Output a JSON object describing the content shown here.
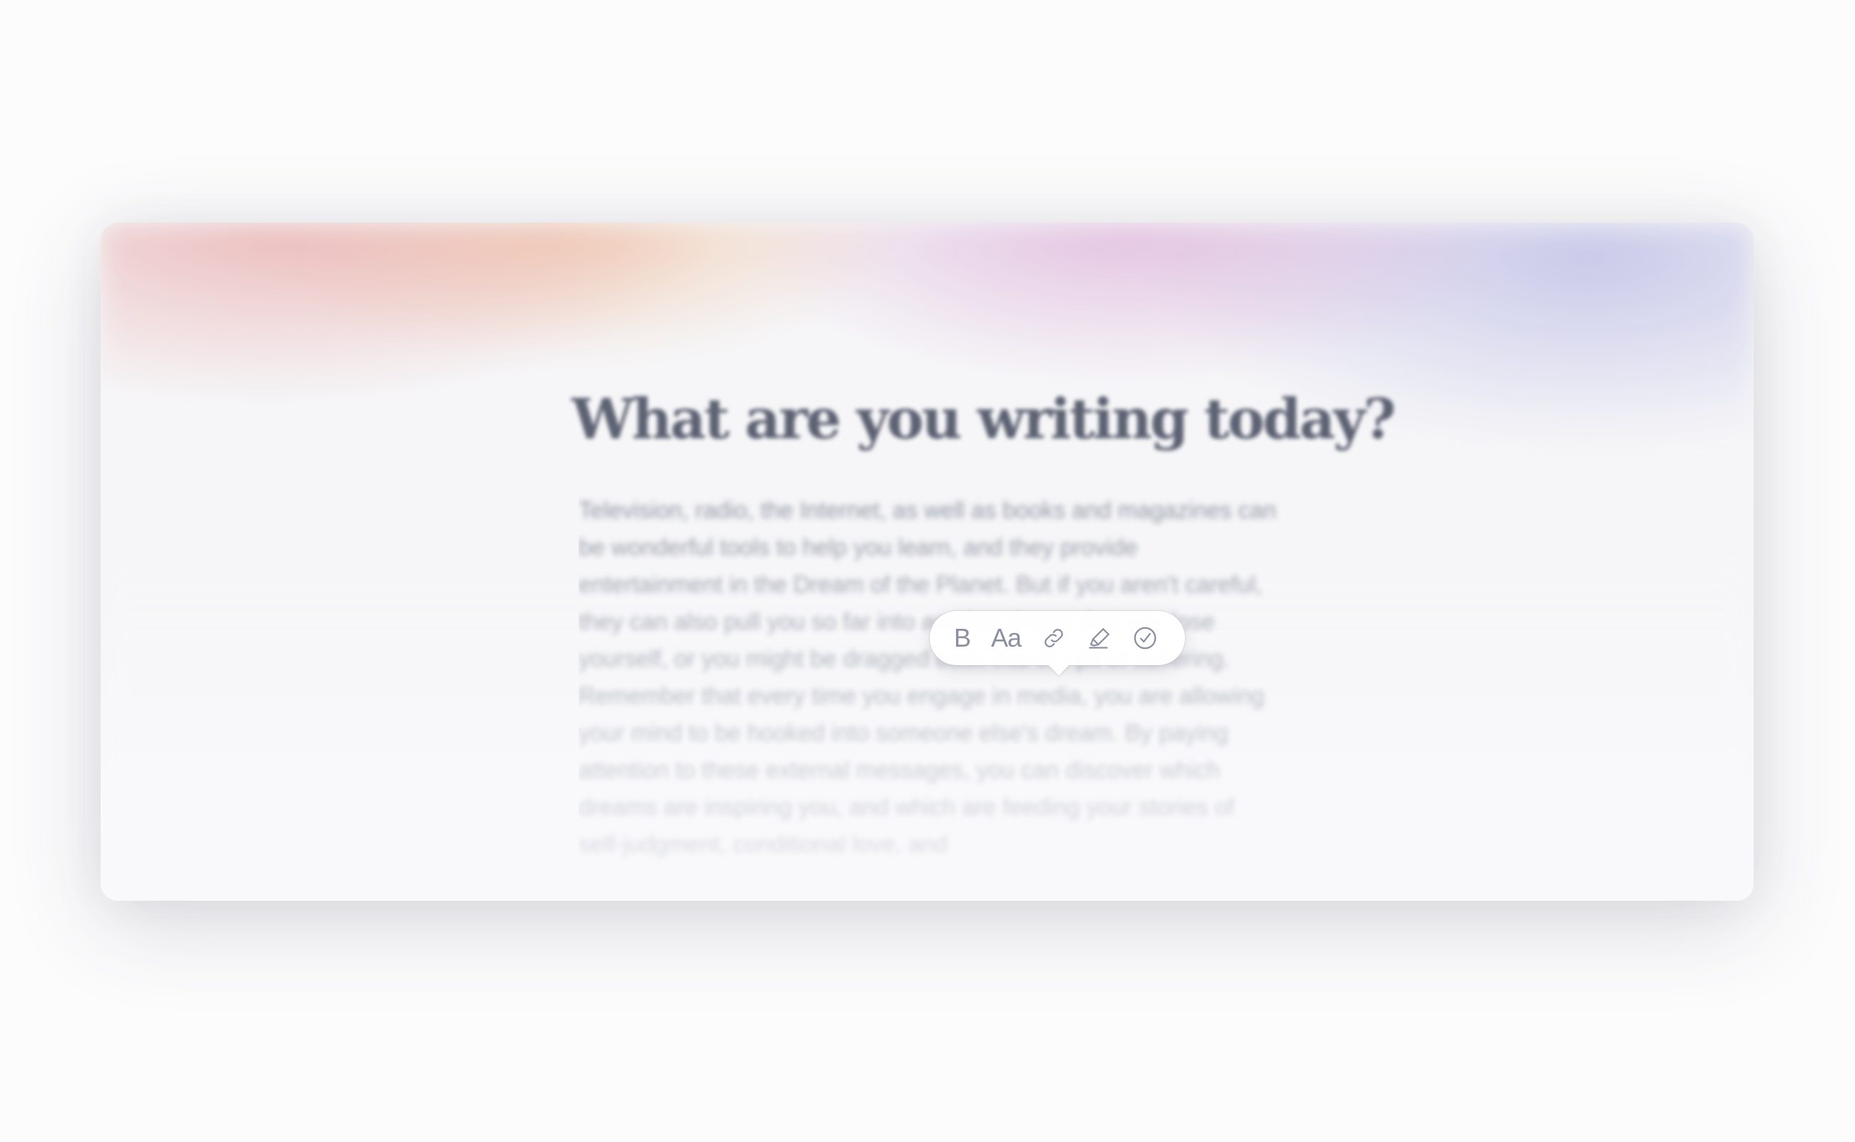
{
  "editor": {
    "title": "What are you writing today?",
    "body": "Television, radio, the Internet, as well as books and magazines can be wonderful tools to help you learn, and they provide entertainment in the Dream of the Planet. But if you aren't careful, they can also pull you so far into another dream that you lose yourself, or you might be dragged back into the pit of suffering. Remember that every time you engage in media, you are allowing your mind to be hooked into someone else's dream. By paying attention to these external messages, you can discover which dreams are inspiring you, and which are feeding your stories of self-judgment, conditional love, and"
  },
  "toolbar": {
    "bold_label": "B",
    "type_label": "Aa",
    "items": [
      {
        "icon": "bold-icon"
      },
      {
        "icon": "text-style-icon"
      },
      {
        "icon": "link-icon"
      },
      {
        "icon": "highlighter-icon"
      },
      {
        "icon": "check-circle-icon"
      }
    ]
  },
  "colors": {
    "text_heading": "#5d6273",
    "text_body": "#8f94a4",
    "toolbar_icon": "#8a90a0",
    "background": "#fcfcfd"
  }
}
